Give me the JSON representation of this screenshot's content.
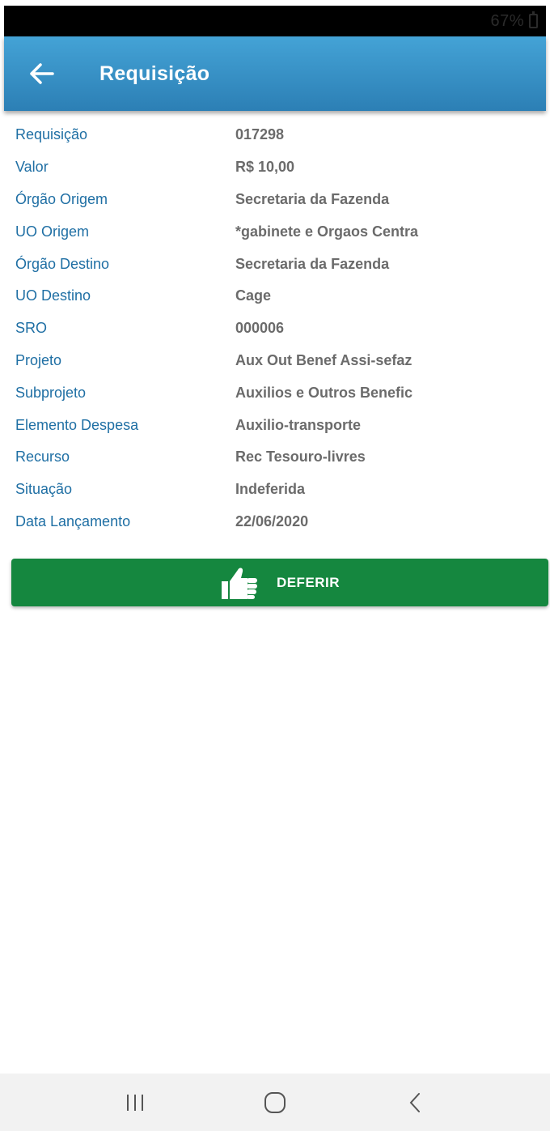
{
  "status_bar": {
    "battery": "67%"
  },
  "app_bar": {
    "title": "Requisição",
    "back_icon": "arrow-left-icon"
  },
  "details": [
    {
      "label": "Requisição",
      "value": "017298"
    },
    {
      "label": "Valor",
      "value": "R$ 10,00"
    },
    {
      "label": "Órgão Origem",
      "value": "Secretaria da Fazenda"
    },
    {
      "label": "UO Origem",
      "value": "*gabinete e Orgaos Centra"
    },
    {
      "label": "Órgão Destino",
      "value": "Secretaria da Fazenda"
    },
    {
      "label": "UO Destino",
      "value": "Cage"
    },
    {
      "label": "SRO",
      "value": "000006"
    },
    {
      "label": "Projeto",
      "value": "Aux Out Benef Assi-sefaz"
    },
    {
      "label": "Subprojeto",
      "value": "Auxilios e Outros Benefic"
    },
    {
      "label": "Elemento Despesa",
      "value": "Auxilio-transporte"
    },
    {
      "label": "Recurso",
      "value": "Rec Tesouro-livres"
    },
    {
      "label": "Situação",
      "value": "Indeferida"
    },
    {
      "label": "Data Lançamento",
      "value": "22/06/2020"
    }
  ],
  "action_button": {
    "label": "DEFERIR",
    "icon": "thumbs-up-icon",
    "color": "#15873f"
  },
  "nav_bar": {
    "recent_icon": "recent-apps-icon",
    "home_icon": "home-icon",
    "back_icon": "back-chevron-icon"
  },
  "colors": {
    "app_bar": "#2f8fc6",
    "label": "#1f6fa4",
    "value": "#6b6b6b"
  }
}
